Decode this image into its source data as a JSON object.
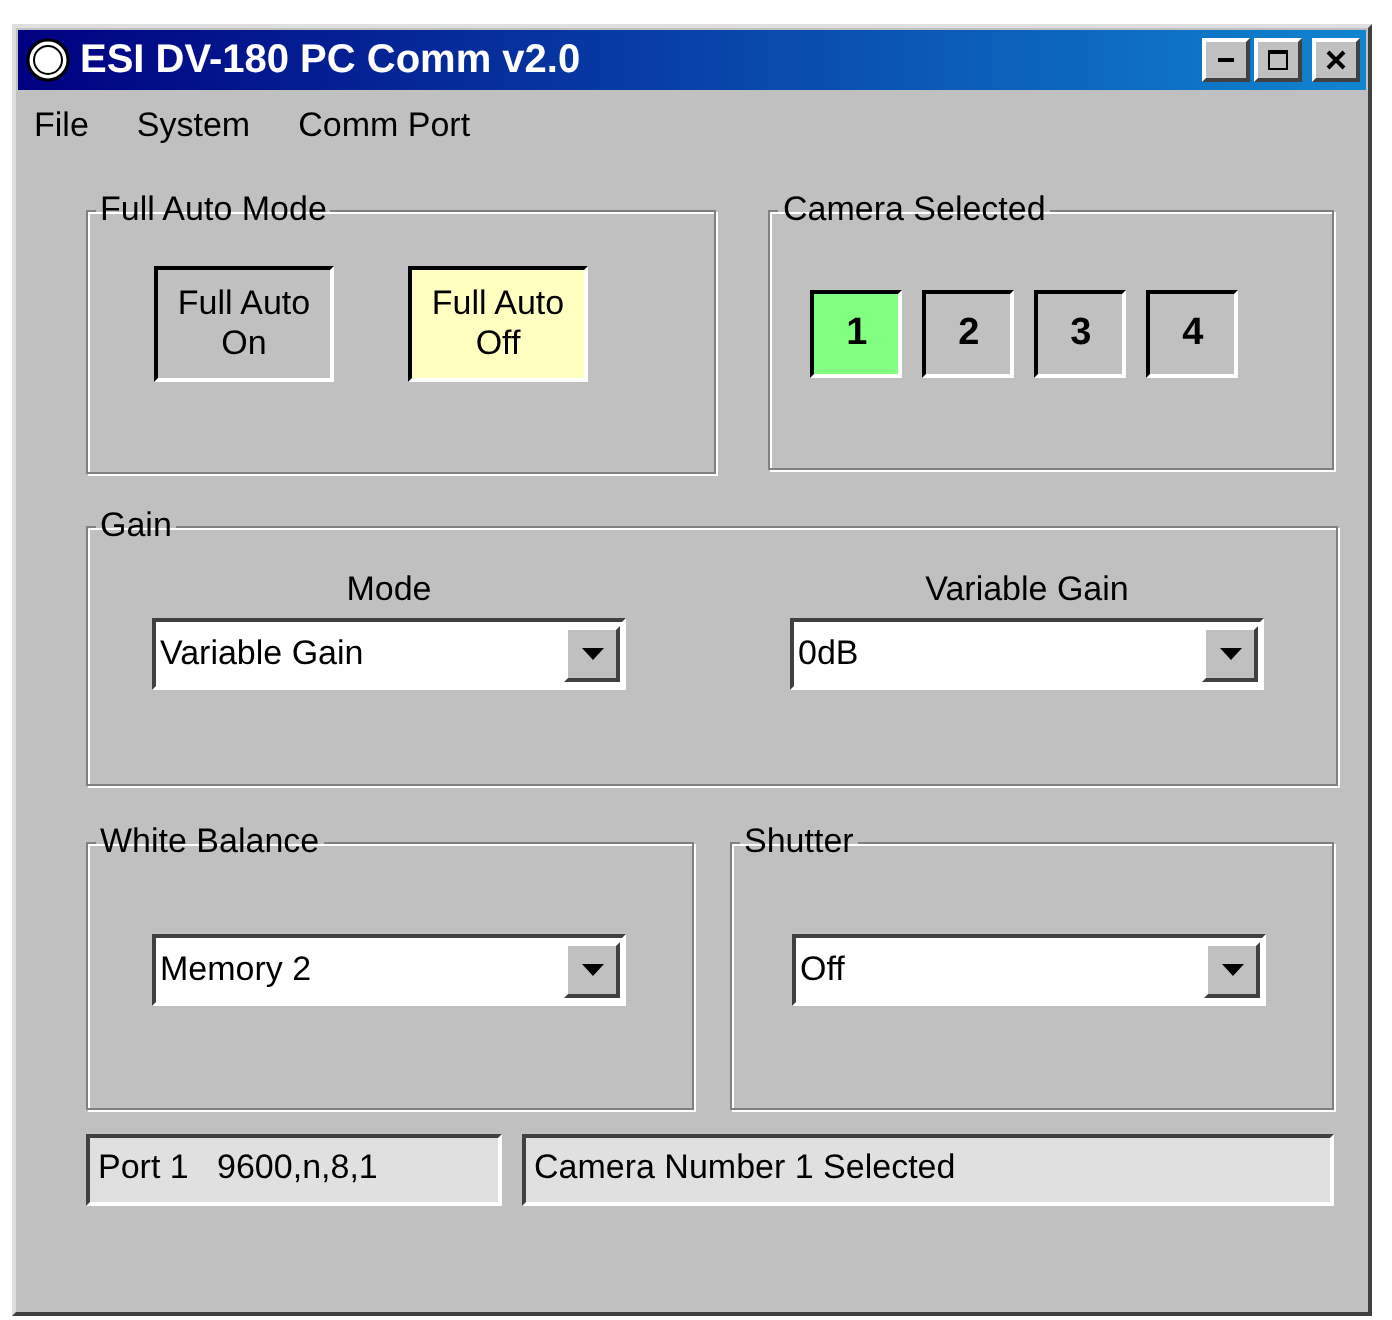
{
  "window": {
    "title": "ESI DV-180 PC Comm v2.0"
  },
  "menu": [
    "File",
    "System",
    "Comm Port"
  ],
  "full_auto_mode": {
    "title": "Full Auto Mode",
    "buttons": [
      {
        "label": "Full Auto\nOn",
        "selected": false
      },
      {
        "label": "Full Auto\nOff",
        "selected": true
      }
    ]
  },
  "camera_selected": {
    "title": "Camera Selected",
    "buttons": [
      {
        "label": "1",
        "selected": true
      },
      {
        "label": "2",
        "selected": false
      },
      {
        "label": "3",
        "selected": false
      },
      {
        "label": "4",
        "selected": false
      }
    ]
  },
  "gain": {
    "title": "Gain",
    "fields": [
      {
        "label": "Mode",
        "value": "Variable Gain"
      },
      {
        "label": "Variable Gain",
        "value": "0dB"
      }
    ]
  },
  "white_balance": {
    "title": "White Balance",
    "value": "Memory 2"
  },
  "shutter": {
    "title": "Shutter",
    "value": "Off"
  },
  "status_bar": [
    "Port 1   9600,n,8,1",
    "Camera Number 1 Selected"
  ]
}
